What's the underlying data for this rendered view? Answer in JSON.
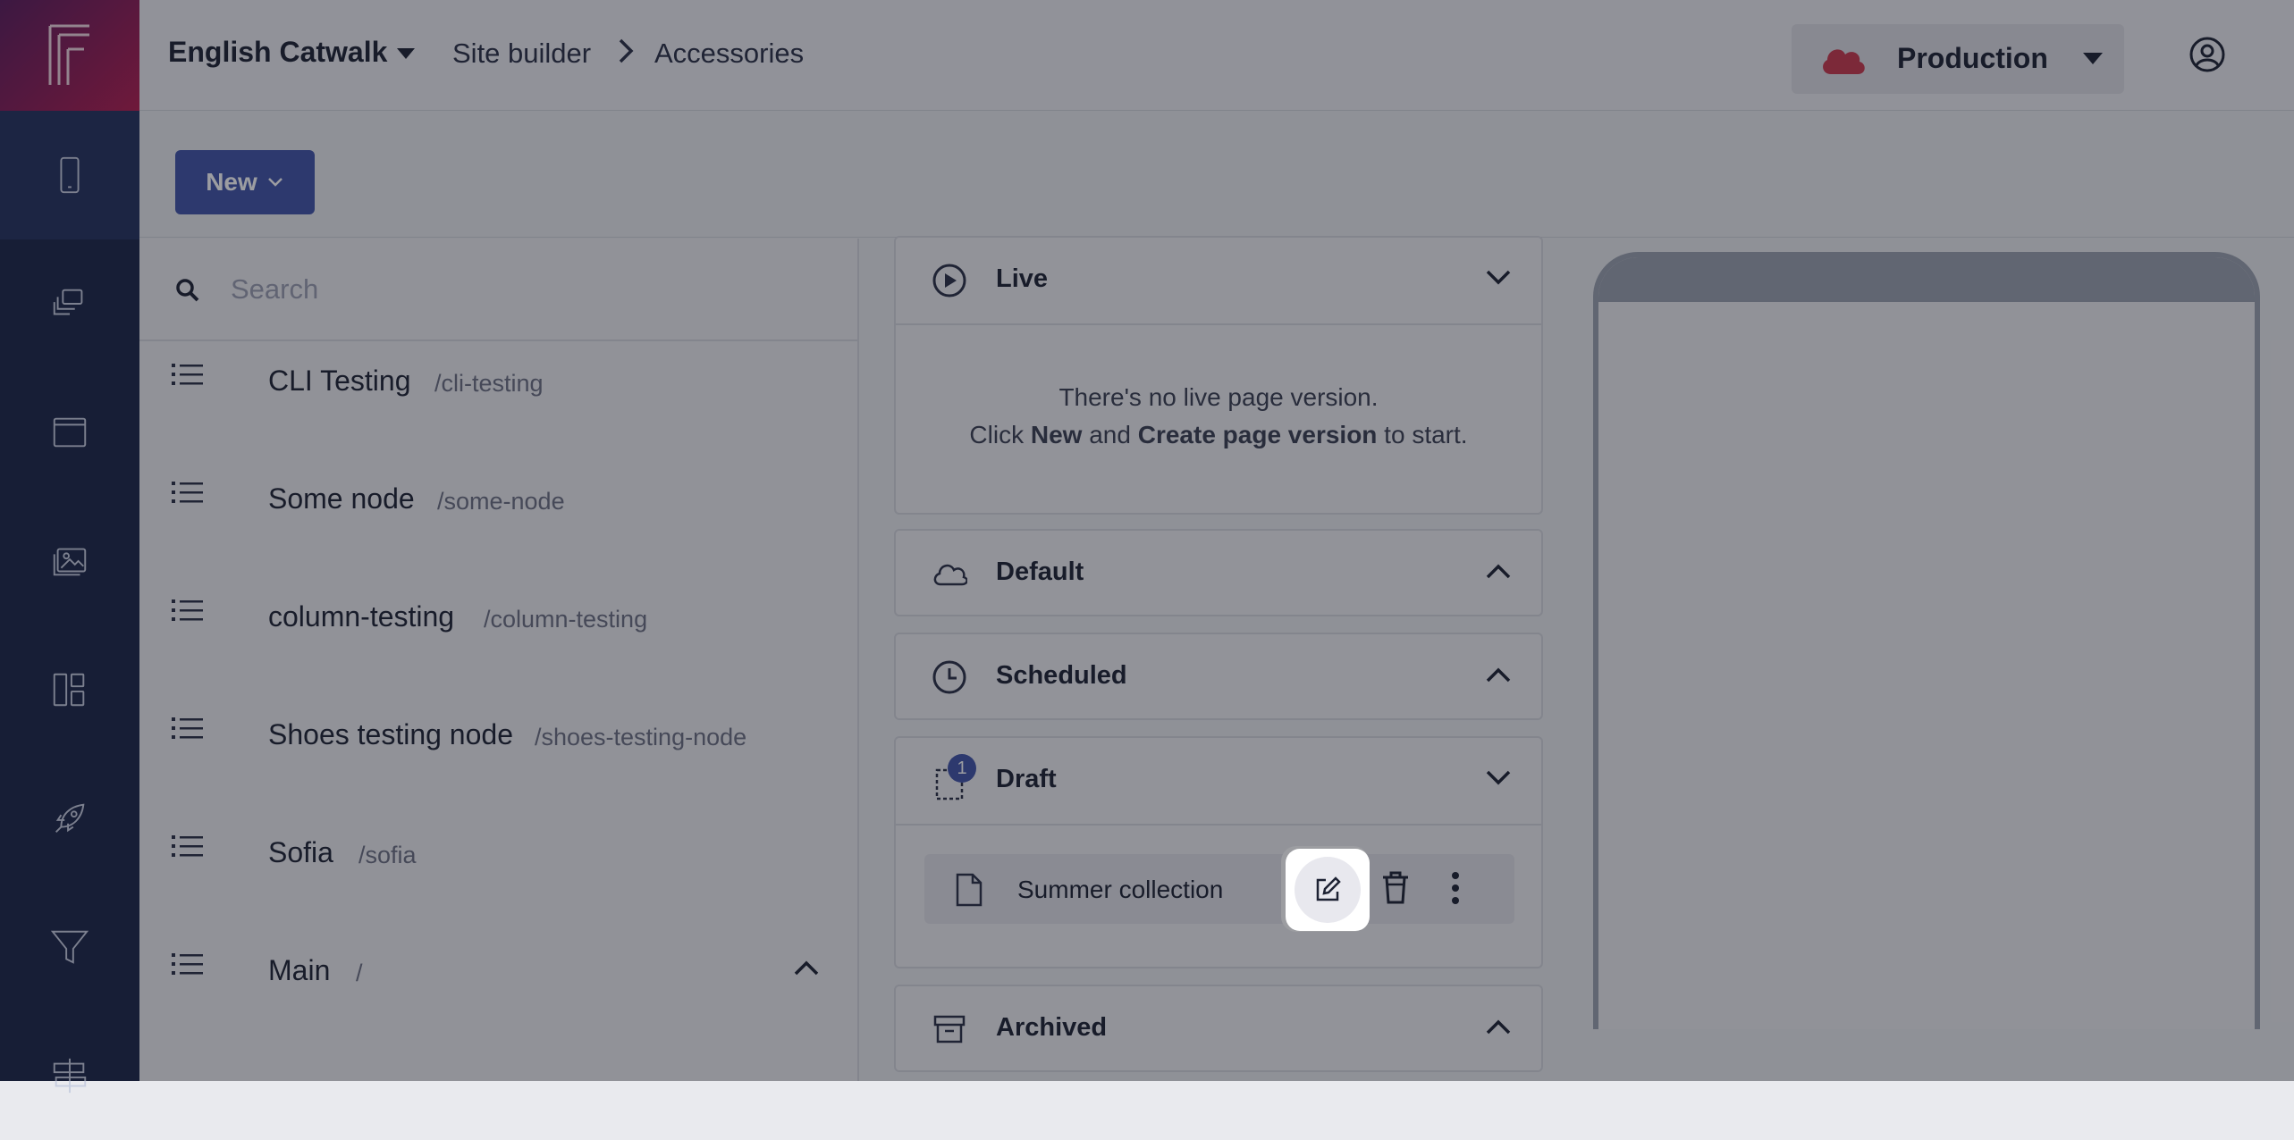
{
  "rail": {
    "items": [
      {
        "icon": "mobile-icon",
        "active": true
      },
      {
        "icon": "layers-icon"
      },
      {
        "icon": "window-icon"
      },
      {
        "icon": "images-icon"
      },
      {
        "icon": "dashboard-icon"
      },
      {
        "icon": "rocket-icon"
      },
      {
        "icon": "filter-icon"
      },
      {
        "icon": "signpost-icon"
      }
    ]
  },
  "header": {
    "app_name": "English Catwalk",
    "breadcrumb": [
      "Site builder",
      "Accessories"
    ],
    "environment": "Production"
  },
  "toolbar": {
    "new_label": "New"
  },
  "tree": {
    "search_placeholder": "Search",
    "nodes": [
      {
        "title": "CLI Testing",
        "path": "/cli-testing"
      },
      {
        "title": "Some node",
        "path": "/some-node"
      },
      {
        "title": "column-testing",
        "path": "/column-testing"
      },
      {
        "title": "Shoes testing node",
        "path": "/shoes-testing-node"
      },
      {
        "title": "Sofia",
        "path": "/sofia"
      },
      {
        "title": "Main",
        "path": "/"
      }
    ]
  },
  "versions": {
    "live": {
      "title": "Live",
      "empty_line1": "There's no live page version.",
      "empty_line2_prefix": "Click ",
      "empty_line2_new": "New",
      "empty_line2_and": " and ",
      "empty_line2_create": "Create page version",
      "empty_line2_suffix": " to start."
    },
    "default": {
      "title": "Default"
    },
    "scheduled": {
      "title": "Scheduled"
    },
    "draft": {
      "title": "Draft",
      "count": "1",
      "items": [
        {
          "name": "Summer collection"
        }
      ]
    },
    "archived": {
      "title": "Archived"
    }
  },
  "colors": {
    "brand": "#4154a8",
    "rail": "#1b2547",
    "env_cloud": "#c8374d"
  }
}
